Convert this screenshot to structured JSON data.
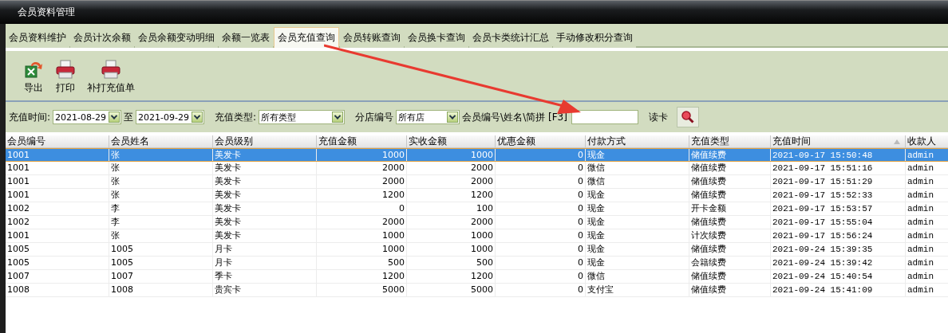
{
  "window": {
    "title": "会员资料管理"
  },
  "tabs": [
    {
      "label": "会员资料维护",
      "selected": false
    },
    {
      "label": "会员计次余额",
      "selected": false
    },
    {
      "label": "会员余额变动明细",
      "selected": false
    },
    {
      "label": "余额一览表",
      "selected": false
    },
    {
      "label": "会员充值查询",
      "selected": true
    },
    {
      "label": "会员转账查询",
      "selected": false
    },
    {
      "label": "会员换卡查询",
      "selected": false
    },
    {
      "label": "会员卡类统计汇总",
      "selected": false
    },
    {
      "label": "手动修改积分查询",
      "selected": false
    }
  ],
  "toolbar": [
    {
      "label": "导出",
      "kind": "export"
    },
    {
      "label": "打印",
      "kind": "print"
    },
    {
      "label": "补打充值单",
      "kind": "print"
    }
  ],
  "filters": {
    "date_label": "充值时间:",
    "date_from": "2021-08-29",
    "to_label": "至",
    "date_to": "2021-09-29",
    "type_label": "充值类型:",
    "type_value": "所有类型",
    "branch_label": "分店编号",
    "branch_value": "所有店",
    "search_label": "会员编号\\姓名\\简拼 [F3]",
    "read_card": "读卡"
  },
  "table": {
    "columns": [
      {
        "label": "会员编号",
        "kind": "text"
      },
      {
        "label": "会员姓名",
        "kind": "text"
      },
      {
        "label": "会员级别",
        "kind": "text"
      },
      {
        "label": "充值金额",
        "kind": "number"
      },
      {
        "label": "实收金额",
        "kind": "number"
      },
      {
        "label": "优惠金额",
        "kind": "number"
      },
      {
        "label": "付款方式",
        "kind": "text"
      },
      {
        "label": "充值类型",
        "kind": "text"
      },
      {
        "label": "充值时间",
        "kind": "mono",
        "sorted": true
      },
      {
        "label": "收款人",
        "kind": "mono"
      }
    ],
    "rows": [
      {
        "selected": true,
        "cells": [
          "1001",
          "张",
          "美发卡",
          "1000",
          "1000",
          "0",
          "现金",
          "储值续费",
          "2021-09-17 15:50:48",
          "admin"
        ]
      },
      {
        "selected": false,
        "cells": [
          "1001",
          "张",
          "美发卡",
          "2000",
          "2000",
          "0",
          "微信",
          "储值续费",
          "2021-09-17 15:51:16",
          "admin"
        ]
      },
      {
        "selected": false,
        "cells": [
          "1001",
          "张",
          "美发卡",
          "2000",
          "2000",
          "0",
          "微信",
          "储值续费",
          "2021-09-17 15:51:29",
          "admin"
        ]
      },
      {
        "selected": false,
        "cells": [
          "1001",
          "张",
          "美发卡",
          "1200",
          "1200",
          "0",
          "现金",
          "储值续费",
          "2021-09-17 15:52:33",
          "admin"
        ]
      },
      {
        "selected": false,
        "cells": [
          "1002",
          "李",
          "美发卡",
          "0",
          "100",
          "0",
          "现金",
          "开卡金额",
          "2021-09-17 15:53:57",
          "admin"
        ]
      },
      {
        "selected": false,
        "cells": [
          "1002",
          "李",
          "美发卡",
          "2000",
          "2000",
          "0",
          "现金",
          "储值续费",
          "2021-09-17 15:55:04",
          "admin"
        ]
      },
      {
        "selected": false,
        "cells": [
          "1001",
          "张",
          "美发卡",
          "1000",
          "1000",
          "0",
          "现金",
          "计次续费",
          "2021-09-17 15:56:24",
          "admin"
        ]
      },
      {
        "selected": false,
        "cells": [
          "1005",
          "1005",
          "月卡",
          "1000",
          "1000",
          "0",
          "现金",
          "储值续费",
          "2021-09-24 15:39:35",
          "admin"
        ]
      },
      {
        "selected": false,
        "cells": [
          "1005",
          "1005",
          "月卡",
          "500",
          "500",
          "0",
          "现金",
          "会籍续费",
          "2021-09-24 15:39:42",
          "admin"
        ]
      },
      {
        "selected": false,
        "cells": [
          "1007",
          "1007",
          "季卡",
          "1200",
          "1200",
          "0",
          "微信",
          "储值续费",
          "2021-09-24 15:40:54",
          "admin"
        ]
      },
      {
        "selected": false,
        "cells": [
          "1008",
          "1008",
          "贵宾卡",
          "5000",
          "5000",
          "0",
          "支付宝",
          "储值续费",
          "2021-09-24 15:41:09",
          "admin"
        ]
      }
    ]
  }
}
